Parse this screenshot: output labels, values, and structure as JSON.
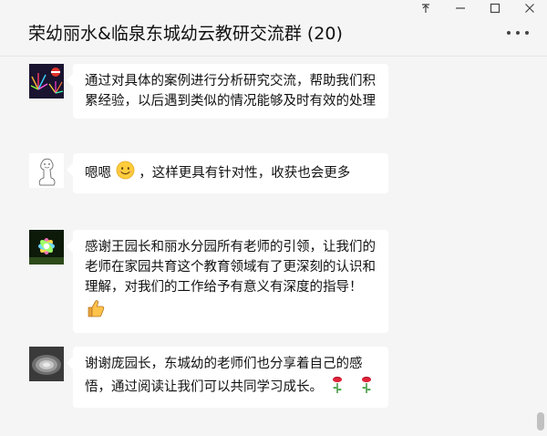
{
  "window": {
    "controls": {
      "pin": "⊼",
      "minimize": "—",
      "maximize": "☐",
      "close": "✕"
    }
  },
  "header": {
    "title": "荣幼丽水&临泉东城幼云教研交流群 (20)",
    "more_icon": "more-dots-icon"
  },
  "messages": [
    {
      "text": "通过对具体的案例进行分析研究交流，帮助我们积累经验，以后遇到类似的情况能够及时有效的处理",
      "avatar": "fireworks-avatar"
    },
    {
      "text_before": "嗯嗯",
      "emoji": "smile-emoji-icon",
      "text_after": "，这样更具有针对性，收获也会更多",
      "avatar": "cartoon-sketch-avatar"
    },
    {
      "text": "感谢王园长和丽水分园所有老师的引领，让我们的老师在家园共育这个教育领域有了更深刻的认识和理解，对我们的工作给予有意义有深度的指导！",
      "emoji": "thumbs-up-emoji-icon",
      "avatar": "flower-avatar"
    },
    {
      "text": "谢谢庞园长，东城幼的老师们也分享着自己的感悟，通过阅读让我们可以共同学习成长。",
      "emoji": "rose-emoji-icon",
      "avatar": "spiral-avatar"
    }
  ],
  "colors": {
    "background": "#f5f5f5",
    "bubble": "#ffffff",
    "text": "#111111"
  }
}
